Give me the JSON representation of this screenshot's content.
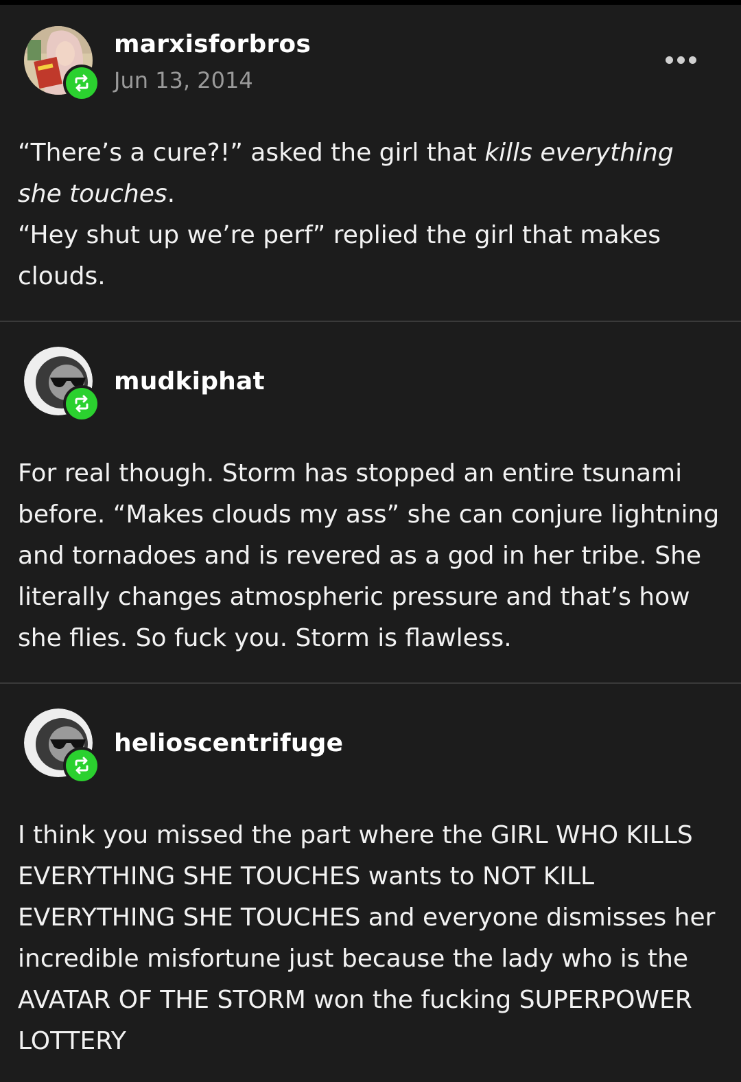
{
  "posts": [
    {
      "username": "marxisforbros",
      "date": "Jun 13, 2014",
      "lines": [
        {
          "parts": [
            {
              "text": "“There’s a cure?!” asked the girl that ",
              "italic": false
            },
            {
              "text": "kills everything she touches",
              "italic": true
            },
            {
              "text": ".",
              "italic": false
            }
          ]
        },
        {
          "parts": [
            {
              "text": "“Hey shut up we’re perf” replied the girl that makes clouds.",
              "italic": false
            }
          ]
        }
      ]
    },
    {
      "username": "mudkiphat",
      "text": "For real though. Storm has stopped an entire tsunami before. “Makes clouds my ass” she can conjure lightning and tornadoes and is revered as a god in her tribe. She literally changes atmospheric pressure and that’s how she flies. So fuck you. Storm is flawless."
    },
    {
      "username": "helioscentrifuge",
      "text": "I think you missed the part where the GIRL WHO KILLS EVERYTHING SHE TOUCHES wants to NOT KILL EVERYTHING SHE TOUCHES and everyone dismisses her incredible misfortune just because the lady who is the AVATAR OF THE STORM won the fucking SUPERPOWER LOTTERY"
    }
  ],
  "icons": {
    "reblog": "reblog-icon",
    "more": "more-options-icon",
    "accent": "#2bd12f"
  }
}
